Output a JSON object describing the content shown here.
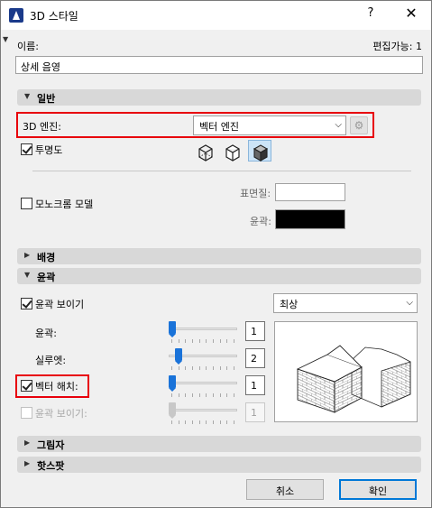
{
  "window": {
    "title": "3D 스타일",
    "help": "?",
    "close": "✕"
  },
  "header": {
    "name_label": "이름:",
    "editable_label": "편집가능: 1",
    "name_value": "상세 음영"
  },
  "sections": {
    "general": "일반",
    "background": "배경",
    "contour": "윤곽",
    "shadow": "그림자",
    "hotspot": "핫스팟"
  },
  "general": {
    "engine_label": "3D 엔진:",
    "engine_value": "벡터 엔진",
    "transparency_label": "투명도",
    "transparency_checked": true,
    "mono_label": "모노크롬 모델",
    "mono_checked": false,
    "surface_label": "표면질:",
    "surface_color": "#ffffff",
    "contour_color_label": "윤곽:",
    "contour_color": "#000000",
    "modes_active_index": 2
  },
  "contour": {
    "show_label": "윤곽 보이기",
    "show_checked": true,
    "quality_value": "최상",
    "contour_label": "윤곽:",
    "contour_value": "1",
    "contour_level": 0,
    "silhouette_label": "실루엣:",
    "silhouette_value": "2",
    "silhouette_level": 0.1,
    "vector_hatch_label": "벡터 해치:",
    "vector_hatch_checked": true,
    "vector_hatch_value": "1",
    "vector_hatch_level": 0,
    "show2_label": "윤곽 보이기:",
    "show2_checked": false,
    "show2_value": "1",
    "show2_level": 0
  },
  "footer": {
    "cancel": "취소",
    "ok": "확인"
  },
  "icons": {
    "app": "archicad-icon",
    "gear": "gear-icon",
    "modes": [
      "wireframe-icon",
      "hidden-line-icon",
      "shaded-icon"
    ]
  }
}
